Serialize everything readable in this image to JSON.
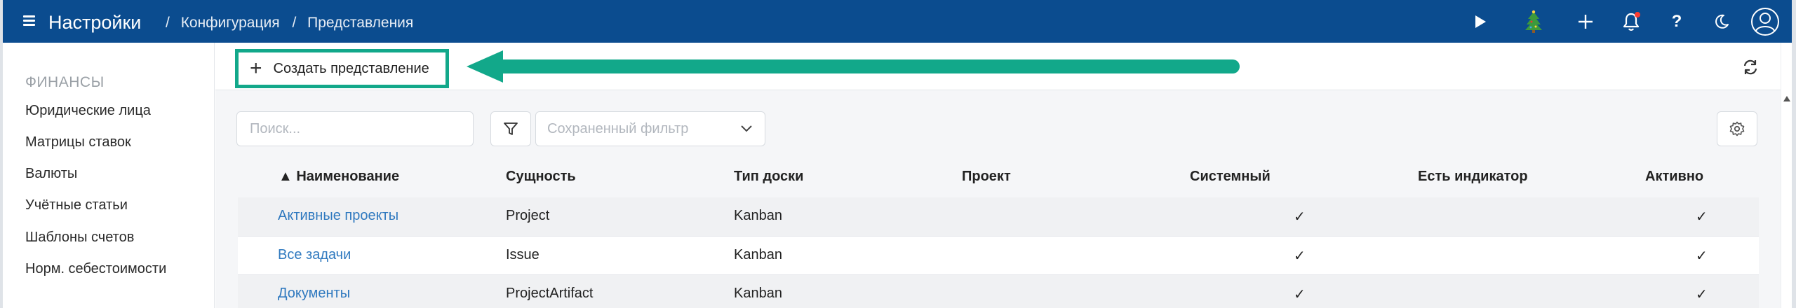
{
  "header": {
    "app_title": "Настройки",
    "breadcrumbs": [
      "Конфигурация",
      "Представления"
    ],
    "breadcrumb_separator": "/",
    "icons": [
      "menu-icon",
      "play-icon",
      "christmas-tree-icon",
      "plus-icon",
      "bell-icon",
      "help-icon",
      "moon-icon",
      "user-avatar-icon"
    ],
    "bg_color": "#0b4c8f",
    "notification_dot_color": "#ff3b30",
    "help_label": "?"
  },
  "sidebar": {
    "section": "ФИНАНСЫ",
    "items": [
      {
        "label": "Юридические лица"
      },
      {
        "label": "Матрицы ставок"
      },
      {
        "label": "Валюты"
      },
      {
        "label": "Учётные статьи"
      },
      {
        "label": "Шаблоны счетов"
      },
      {
        "label": "Норм. себестоимости"
      }
    ]
  },
  "toolbar": {
    "create_label": "Создать представление",
    "create_icon": "plus-icon",
    "highlight_color": "#12a88a",
    "refresh_icon": "refresh-icon"
  },
  "filters": {
    "search_placeholder": "Поиск...",
    "filter_icon": "filter-icon",
    "saved_filter_placeholder": "Сохраненный фильтр",
    "saved_filter_icon": "chevron-down-icon",
    "settings_icon": "gear-icon"
  },
  "table": {
    "sort_indicator": "▲",
    "columns": [
      "Наименование",
      "Сущность",
      "Тип доски",
      "Проект",
      "Системный",
      "Есть индикатор",
      "Активно"
    ],
    "check_mark": "✓",
    "rows": [
      {
        "name": "Активные проекты",
        "entity": "Project",
        "board_type": "Kanban",
        "project": "",
        "system": true,
        "has_indicator": false,
        "active": true
      },
      {
        "name": "Все задачи",
        "entity": "Issue",
        "board_type": "Kanban",
        "project": "",
        "system": true,
        "has_indicator": false,
        "active": true
      },
      {
        "name": "Документы",
        "entity": "ProjectArtifact",
        "board_type": "Kanban",
        "project": "",
        "system": true,
        "has_indicator": false,
        "active": true
      }
    ],
    "link_color": "#2f79bf"
  }
}
